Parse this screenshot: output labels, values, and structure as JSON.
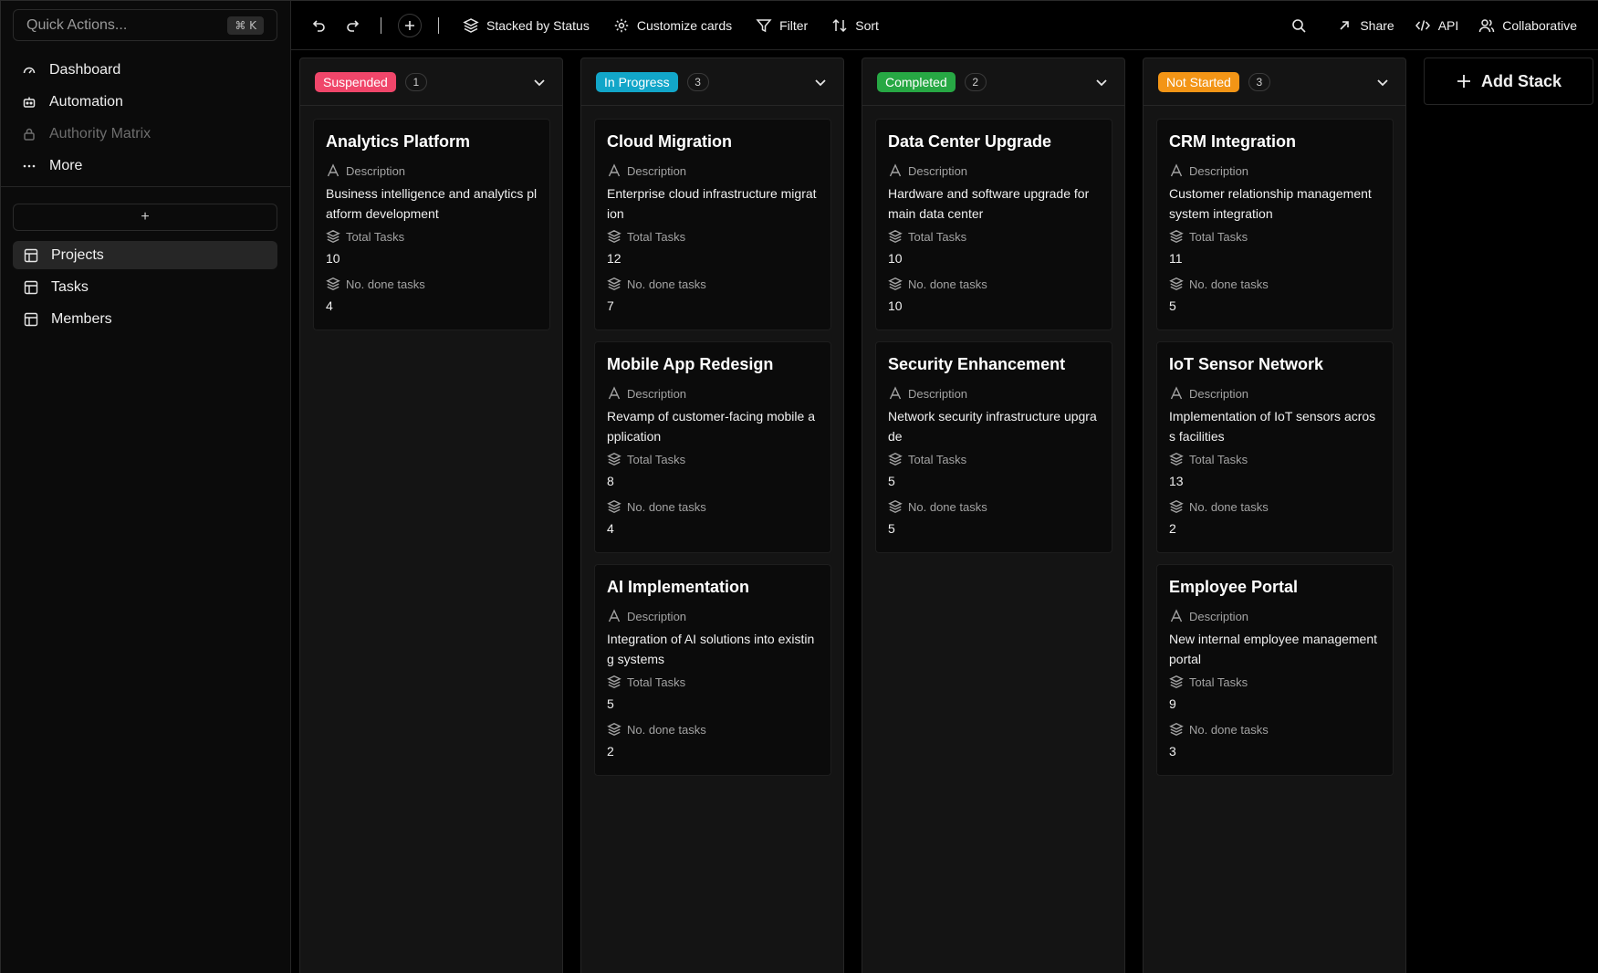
{
  "sidebar": {
    "quick_actions": {
      "placeholder": "Quick Actions...",
      "shortcut": "⌘ K"
    },
    "nav": [
      {
        "label": "Dashboard",
        "icon": "gauge-icon",
        "disabled": false
      },
      {
        "label": "Automation",
        "icon": "robot-icon",
        "disabled": false
      },
      {
        "label": "Authority Matrix",
        "icon": "lock-icon",
        "disabled": true
      },
      {
        "label": "More",
        "icon": "more-dots-icon",
        "disabled": false
      }
    ],
    "add_label": "+",
    "tables": [
      {
        "label": "Projects",
        "active": true
      },
      {
        "label": "Tasks",
        "active": false
      },
      {
        "label": "Members",
        "active": false
      }
    ]
  },
  "toolbar": {
    "stacked_by": "Stacked by Status",
    "customize": "Customize cards",
    "filter": "Filter",
    "sort": "Sort",
    "share": "Share",
    "api": "API",
    "collaborative": "Collaborative"
  },
  "field_labels": {
    "description": "Description",
    "total": "Total Tasks",
    "done": "No. done tasks"
  },
  "stacks": [
    {
      "status": "Suspended",
      "color": "#f0466a",
      "count": "1",
      "cards": [
        {
          "title": "Analytics Platform",
          "description": "Business intelligence and analytics platform development",
          "total": "10",
          "done": "4"
        }
      ]
    },
    {
      "status": "In Progress",
      "color": "#12a6c9",
      "count": "3",
      "cards": [
        {
          "title": "Cloud Migration",
          "description": "Enterprise cloud infrastructure migration",
          "total": "12",
          "done": "7"
        },
        {
          "title": "Mobile App Redesign",
          "description": "Revamp of customer-facing mobile application",
          "total": "8",
          "done": "4"
        },
        {
          "title": "AI Implementation",
          "description": "Integration of AI solutions into existing systems",
          "total": "5",
          "done": "2"
        }
      ]
    },
    {
      "status": "Completed",
      "color": "#27a844",
      "count": "2",
      "cards": [
        {
          "title": "Data Center Upgrade",
          "description": "Hardware and software upgrade for main data center",
          "total": "10",
          "done": "10"
        },
        {
          "title": "Security Enhancement",
          "description": "Network security infrastructure upgrade",
          "total": "5",
          "done": "5"
        }
      ]
    },
    {
      "status": "Not Started",
      "color": "#f39516",
      "count": "3",
      "cards": [
        {
          "title": "CRM Integration",
          "description": "Customer relationship management system integration",
          "total": "11",
          "done": "5"
        },
        {
          "title": "IoT Sensor Network",
          "description": "Implementation of IoT sensors across facilities",
          "total": "13",
          "done": "2"
        },
        {
          "title": "Employee Portal",
          "description": "New internal employee management portal",
          "total": "9",
          "done": "3"
        }
      ]
    }
  ],
  "add_stack_label": "Add Stack"
}
